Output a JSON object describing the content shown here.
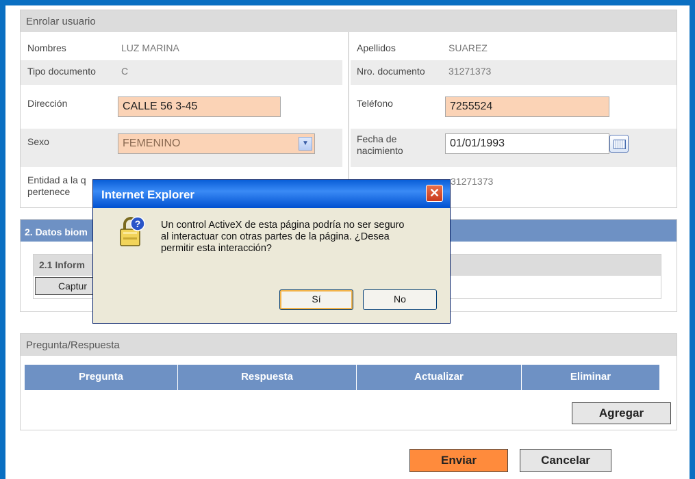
{
  "section1": {
    "title": "Enrolar usuario",
    "nombres_label": "Nombres",
    "nombres_value": "LUZ MARINA",
    "apellidos_label": "Apellidos",
    "apellidos_value": "SUAREZ",
    "tipo_doc_label": "Tipo documento",
    "tipo_doc_value": "C",
    "nro_doc_label": "Nro. documento",
    "nro_doc_value": "31271373",
    "direccion_label": "Dirección",
    "direccion_value": "CALLE 56  3-45",
    "telefono_label": "Teléfono",
    "telefono_value": "7255524",
    "sexo_label": "Sexo",
    "sexo_value": "FEMENINO",
    "fecha_label": "Fecha de nacimiento",
    "fecha_value": "01/01/1993",
    "entidad_label_1": "Entidad a la q",
    "entidad_label_2": "pertenece",
    "entidad_value_partial": "31271373"
  },
  "section2": {
    "title_partial": "2. Datos biom",
    "subtitle_partial": "2.1 Inform",
    "capture_button_partial": "Captur"
  },
  "section3": {
    "title": "Pregunta/Respuesta",
    "columns": [
      "Pregunta",
      "Respuesta",
      "Actualizar",
      "Eliminar"
    ],
    "add_button": "Agregar"
  },
  "footer": {
    "submit": "Enviar",
    "cancel": "Cancelar"
  },
  "dialog": {
    "title": "Internet Explorer",
    "close_glyph": "✕",
    "message_line1": "Un control ActiveX de esta página podría no ser seguro",
    "message_line2": "al interactuar con otras partes de la página. ¿Desea",
    "message_line3": "permitir esta interacción?",
    "yes": "Sí",
    "no": "No"
  },
  "icons": {
    "warning": "padlock-question-icon",
    "calendar": "calendar-icon",
    "dropdown": "chevron-down-icon"
  },
  "colors": {
    "frame": "#0a6fc2",
    "header_blue": "#6e91c4",
    "input_fill": "#fbd3b6",
    "submit_orange": "#ff8b3c"
  }
}
